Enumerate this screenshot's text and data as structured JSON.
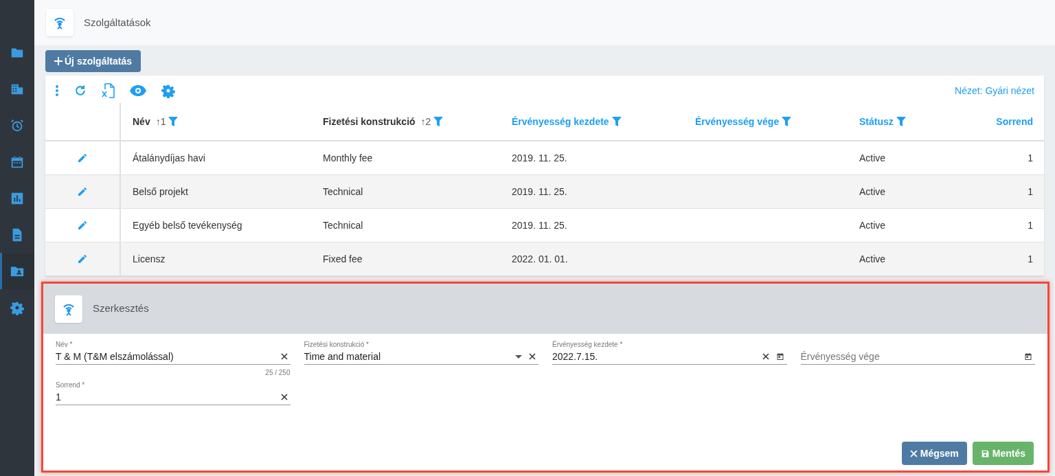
{
  "sidebar": {
    "items": [
      {
        "selected": false
      },
      {
        "selected": false
      },
      {
        "selected": false
      },
      {
        "selected": false
      },
      {
        "selected": false
      },
      {
        "selected": false
      },
      {
        "selected": true
      },
      {
        "selected": false
      }
    ]
  },
  "page": {
    "title": "Szolgáltatások"
  },
  "new_button": {
    "label": "Új szolgáltatás"
  },
  "toolbar": {
    "view": "Nézet: Gyári nézet"
  },
  "table": {
    "columns": [
      {
        "label": "Név",
        "sort": "↑1",
        "filter": true,
        "sorted": true
      },
      {
        "label": "Fizetési konstrukció",
        "sort": "↑2",
        "filter": true,
        "sorted": true
      },
      {
        "label": "Érvényesség kezdete",
        "filter": true,
        "sorted": false
      },
      {
        "label": "Érvényesség vége",
        "filter": true,
        "sorted": false
      },
      {
        "label": "Státusz",
        "filter": true,
        "sorted": false
      },
      {
        "label": "Sorrend",
        "filter": false,
        "sorted": false
      }
    ],
    "rows": [
      {
        "cells": [
          "Átalánydíjas havi",
          "Monthly fee",
          "2019. 11. 25.",
          "",
          "Active",
          "1"
        ]
      },
      {
        "cells": [
          "Belső projekt",
          "Technical",
          "2019. 11. 25.",
          "",
          "Active",
          "1"
        ]
      },
      {
        "cells": [
          "Egyéb belső tevékenység",
          "Technical",
          "2019. 11. 25.",
          "",
          "Active",
          "1"
        ]
      },
      {
        "cells": [
          "Licensz",
          "Fixed fee",
          "2022. 01. 01.",
          "",
          "Active",
          "1"
        ]
      }
    ]
  },
  "editor": {
    "title": "Szerkesztés",
    "highlighted": true,
    "fields": [
      {
        "kind": "text",
        "label": "Név *",
        "value": "T & M (T&M elszámolással)",
        "counter": "25 / 250",
        "clearable": true
      },
      {
        "kind": "select",
        "label": "Fizetési konstrukció *",
        "value": "Time and material",
        "clearable": true
      },
      {
        "kind": "date",
        "label": "Érvényesség kezdete *",
        "value": "2022.7.15.",
        "clearable": true
      },
      {
        "kind": "date",
        "placeholder": "Érvényesség vége",
        "clearable": false
      },
      {
        "kind": "text",
        "label": "Sorrend *",
        "value": "1",
        "clearable": true
      }
    ],
    "buttons": [
      {
        "kind": "cancel",
        "label": "Mégsem"
      },
      {
        "kind": "save",
        "label": "Mentés"
      }
    ]
  }
}
